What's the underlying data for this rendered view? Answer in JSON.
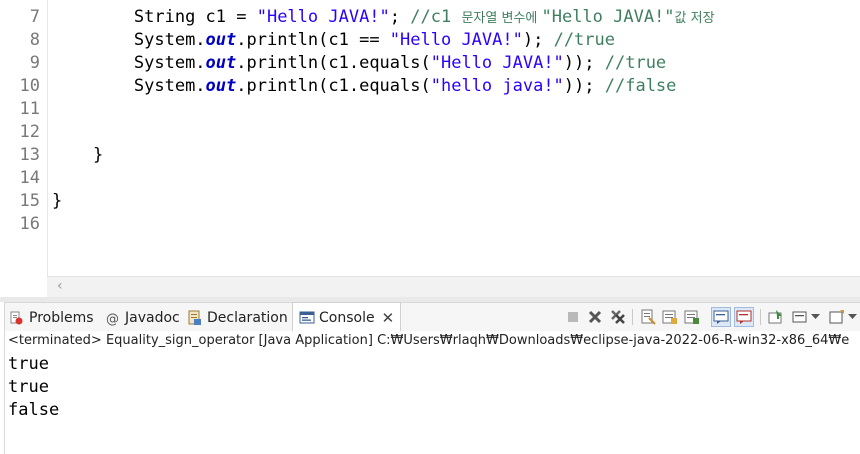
{
  "editor": {
    "line_numbers": [
      "7",
      "8",
      "9",
      "10",
      "11",
      "12",
      "13",
      "14",
      "15",
      "16"
    ],
    "lines": {
      "l7": {
        "indent": "        ",
        "t1": "String c1 = ",
        "s1": "\"Hello JAVA!\"",
        "t2": "; ",
        "c1": "//c1 ",
        "c_ko1": "문자열 변수에 ",
        "c2": "\"Hello JAVA!\"",
        "c_ko2": "값 저장"
      },
      "l8": {
        "indent": "        ",
        "t1": "System.",
        "f1": "out",
        "t2": ".println(c1 == ",
        "s1": "\"Hello JAVA!\"",
        "t3": "); ",
        "c1": "//true"
      },
      "l9": {
        "indent": "        ",
        "t1": "System.",
        "f1": "out",
        "t2": ".println(c1.equals(",
        "s1": "\"Hello JAVA!\"",
        "t3": ")); ",
        "c1": "//true"
      },
      "l10": {
        "indent": "        ",
        "t1": "System.",
        "f1": "out",
        "t2": ".println(c1.equals(",
        "s1": "\"hello java!\"",
        "t3": ")); ",
        "c1": "//false"
      },
      "l13": {
        "indent": "    ",
        "t1": "}"
      },
      "l15": {
        "indent": "",
        "t1": "}"
      }
    }
  },
  "views": {
    "tabs": [
      {
        "label": "Problems",
        "icon": "problems-icon"
      },
      {
        "label": "Javadoc",
        "icon": "javadoc-icon"
      },
      {
        "label": "Declaration",
        "icon": "declaration-icon"
      },
      {
        "label": "Console",
        "icon": "console-icon",
        "active": true
      }
    ],
    "close_glyph": "✕"
  },
  "console": {
    "status": "<terminated> Equality_sign_operator [Java Application] C:₩Users₩rlaqh₩Downloads₩eclipse-java-2022-06-R-win32-x86_64₩e",
    "output": [
      "true",
      "true",
      "false"
    ]
  },
  "colors": {
    "string": "#2a00ff",
    "comment": "#3f7f5f",
    "field": "#0000c0",
    "line_number": "#787878"
  }
}
